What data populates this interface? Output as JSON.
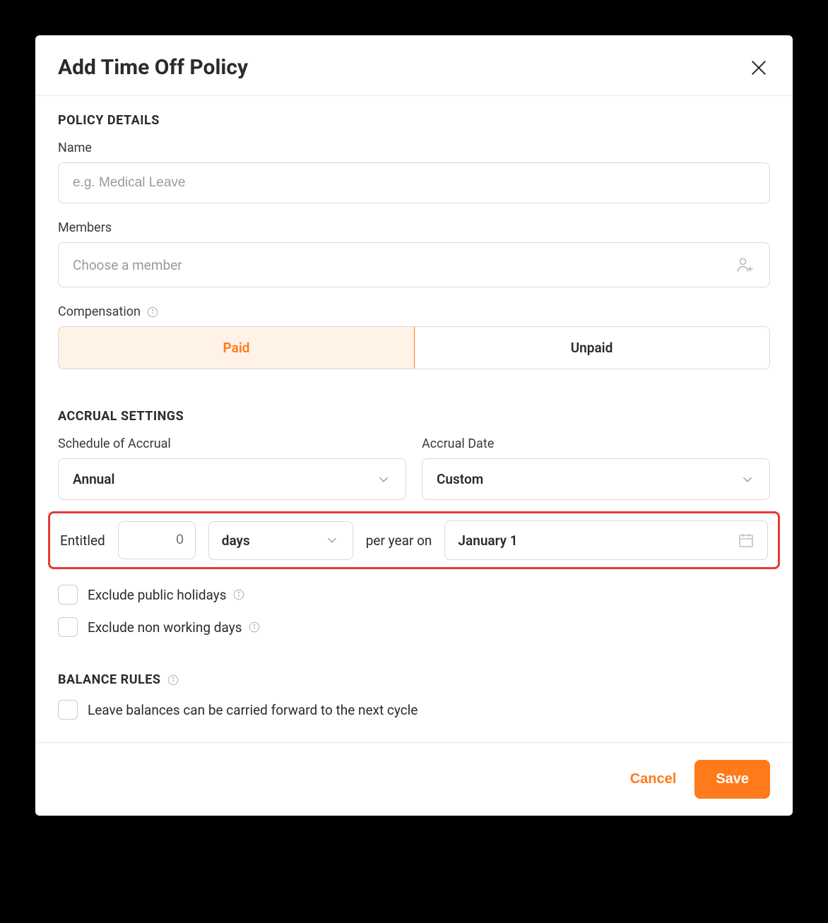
{
  "header": {
    "title": "Add Time Off Policy"
  },
  "sections": {
    "policy_details": {
      "heading": "POLICY DETAILS",
      "name_label": "Name",
      "name_placeholder": "e.g. Medical Leave",
      "members_label": "Members",
      "members_placeholder": "Choose a member",
      "compensation_label": "Compensation",
      "compensation_options": {
        "paid": "Paid",
        "unpaid": "Unpaid"
      },
      "compensation_selected": "paid"
    },
    "accrual_settings": {
      "heading": "ACCRUAL SETTINGS",
      "schedule_label": "Schedule of Accrual",
      "schedule_value": "Annual",
      "date_label": "Accrual Date",
      "date_value": "Custom",
      "entitled_label": "Entitled",
      "entitled_value": "0",
      "unit_value": "days",
      "per_label": "per year on",
      "accrual_on_date": "January 1",
      "exclude_holidays": "Exclude public holidays",
      "exclude_nonworking": "Exclude non working days"
    },
    "balance_rules": {
      "heading": "BALANCE RULES",
      "carry_forward": "Leave balances can be carried forward to the next cycle"
    }
  },
  "footer": {
    "cancel": "Cancel",
    "save": "Save"
  },
  "colors": {
    "accent": "#ff7a1a",
    "highlight_border": "#e53935"
  }
}
